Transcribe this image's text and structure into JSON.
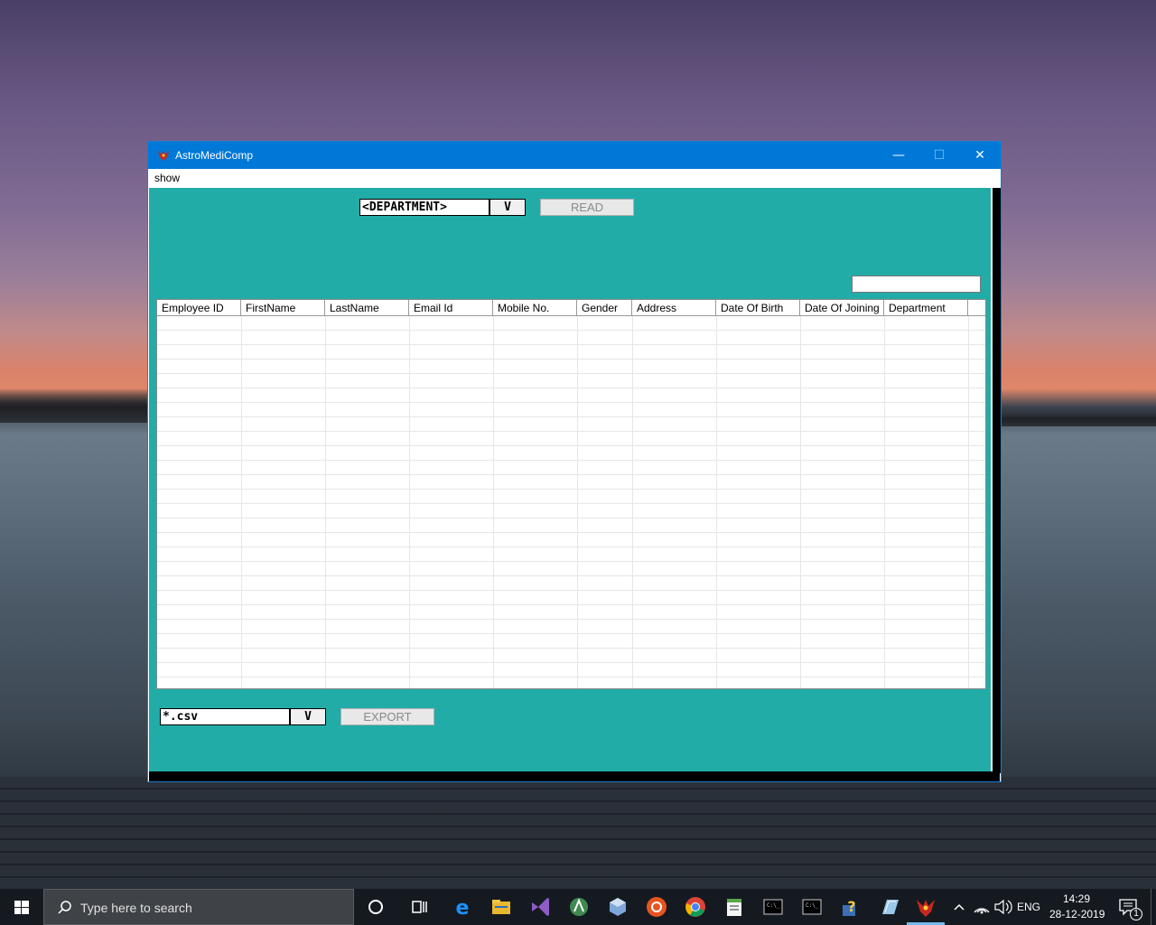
{
  "window": {
    "title": "AstroMediComp",
    "controls": {
      "minimize": "—",
      "maximize": "☐",
      "close": "✕"
    }
  },
  "menu": {
    "items": [
      "show"
    ]
  },
  "department_combo": {
    "value": "<DEPARTMENT>",
    "dropdown_label": "V"
  },
  "read_button": {
    "label": "READ"
  },
  "table": {
    "columns": [
      "Employee ID",
      "FirstName",
      "LastName",
      "Email Id",
      "Mobile No.",
      "Gender",
      "Address",
      "Date Of Birth",
      "Date Of Joining",
      "Department"
    ],
    "rows": []
  },
  "export_combo": {
    "value": "*.csv",
    "dropdown_label": "V"
  },
  "export_button": {
    "label": "EXPORT"
  },
  "taskbar": {
    "search_placeholder": "Type here to search",
    "language": "ENG",
    "time": "14:29",
    "date": "28-12-2019",
    "notification_count": "1",
    "icons": [
      "cortana-icon",
      "task-view-icon",
      "edge-icon",
      "file-explorer-icon",
      "visual-studio-icon",
      "android-studio-icon",
      "virtualbox-icon",
      "ubuntu-icon",
      "chrome-icon",
      "notepad-icon",
      "terminal-icon",
      "terminal-icon",
      "help-icon",
      "paint-icon",
      "astromedicomp-icon"
    ]
  },
  "colors": {
    "titlebar": "#0078d7",
    "client_bg": "#22aca8",
    "taskbar": "#151a21"
  }
}
